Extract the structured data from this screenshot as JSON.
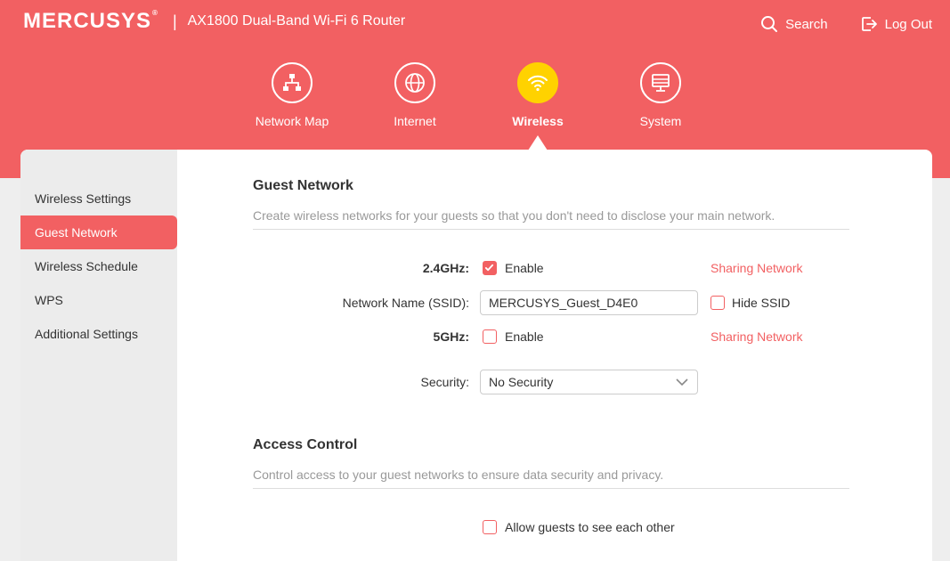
{
  "header": {
    "brand": "MERCUSYS",
    "brand_mark": "®",
    "separator": "|",
    "model": "AX1800 Dual-Band Wi-Fi 6 Router",
    "search_label": "Search",
    "logout_label": "Log Out"
  },
  "nav": [
    {
      "label": "Network Map",
      "icon": "network-map-icon",
      "active": false
    },
    {
      "label": "Internet",
      "icon": "globe-icon",
      "active": false
    },
    {
      "label": "Wireless",
      "icon": "wifi-icon",
      "active": true
    },
    {
      "label": "System",
      "icon": "system-icon",
      "active": false
    }
  ],
  "sidebar": {
    "items": [
      {
        "label": "Wireless Settings",
        "active": false
      },
      {
        "label": "Guest Network",
        "active": true
      },
      {
        "label": "Wireless Schedule",
        "active": false
      },
      {
        "label": "WPS",
        "active": false
      },
      {
        "label": "Additional Settings",
        "active": false
      }
    ]
  },
  "guest": {
    "title": "Guest Network",
    "description": "Create wireless networks for your guests so that you don't need to disclose your main network.",
    "band24_label": "2.4GHz",
    "band24_enable_label": "Enable",
    "band24_enabled": true,
    "band24_sharing": "Sharing Network",
    "ssid_label": "Network Name (SSID):",
    "ssid_value": "MERCUSYS_Guest_D4E0",
    "hide_ssid_label": "Hide SSID",
    "hide_ssid_checked": false,
    "band5_label": "5GHz",
    "band5_enable_label": "Enable",
    "band5_enabled": false,
    "band5_sharing": "Sharing Network",
    "security_label": "Security:",
    "security_value": "No Security"
  },
  "access": {
    "title": "Access Control",
    "description": "Control access to your guest networks to ensure data security and privacy.",
    "allow_label": "Allow guests to see each other",
    "allow_checked": false
  },
  "colors": {
    "accent": "#f26062",
    "active_nav": "#ffd200"
  }
}
